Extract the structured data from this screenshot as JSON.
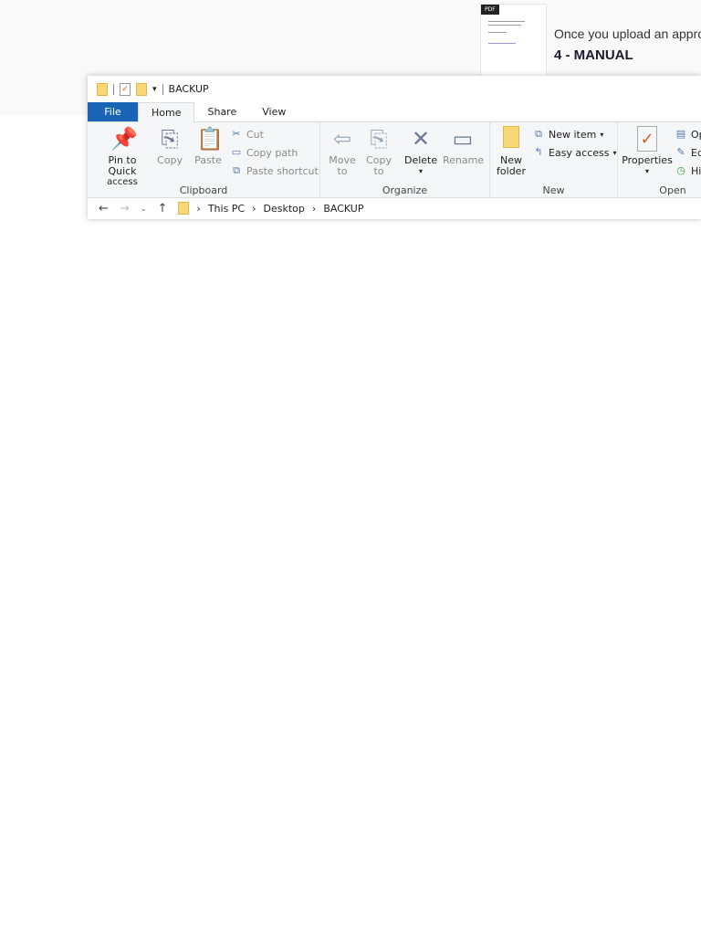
{
  "background_doc": {
    "badge": "PDF",
    "description": "Once you upload an approv",
    "title": "4 - MANUAL"
  },
  "window": {
    "title": "BACKUP",
    "tabs": [
      "File",
      "Home",
      "Share",
      "View"
    ],
    "clipboard": {
      "label": "Clipboard",
      "pin": "Pin to Quick",
      "pin2": "access",
      "copy": "Copy",
      "paste": "Paste",
      "cut": "Cut",
      "copy_path": "Copy path",
      "paste_shortcut": "Paste shortcut"
    },
    "organize": {
      "label": "Organize",
      "move": "Move",
      "move2": "to",
      "copy": "Copy",
      "copy2": "to",
      "delete": "Delete",
      "rename": "Rename"
    },
    "new": {
      "label": "New",
      "new_folder": "New",
      "new_folder2": "folder",
      "new_item": "New item",
      "easy_access": "Easy access"
    },
    "open": {
      "label": "Open",
      "properties": "Properties",
      "open": "Open",
      "edit": "Edit",
      "history": "History"
    },
    "address": {
      "crumbs": [
        "This PC",
        "Desktop",
        "BACKUP"
      ]
    }
  }
}
